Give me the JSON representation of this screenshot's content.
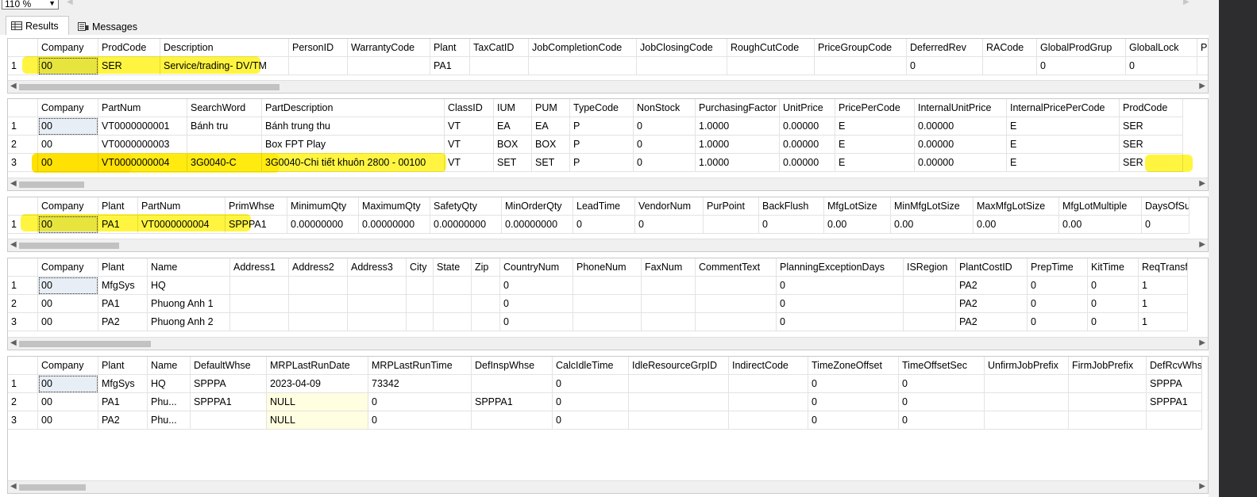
{
  "toolbar": {
    "zoom": "110 %"
  },
  "tabs": [
    {
      "label": "Results",
      "icon": "grid-icon"
    },
    {
      "label": "Messages",
      "icon": "messages-icon"
    }
  ],
  "grids": [
    {
      "name": "prodgroup",
      "columns": [
        "Company",
        "ProdCode",
        "Description",
        "PersonID",
        "WarrantyCode",
        "Plant",
        "TaxCatID",
        "JobCompletionCode",
        "JobClosingCode",
        "RoughCutCode",
        "PriceGroupCode",
        "DeferredRev",
        "RACode",
        "GlobalProdGrup",
        "GlobalLock",
        "P"
      ],
      "rows": [
        [
          "1",
          "00",
          "SER",
          "Service/trading- DV/TM",
          "",
          "",
          "PA1",
          "",
          "",
          "",
          "",
          "",
          "0",
          "",
          "0",
          "0",
          ""
        ]
      ]
    },
    {
      "name": "part",
      "columns": [
        "Company",
        "PartNum",
        "SearchWord",
        "PartDescription",
        "ClassID",
        "IUM",
        "PUM",
        "TypeCode",
        "NonStock",
        "PurchasingFactor",
        "UnitPrice",
        "PricePerCode",
        "InternalUnitPrice",
        "InternalPricePerCode",
        "ProdCode"
      ],
      "rows": [
        [
          "1",
          "00",
          "VT0000000001",
          "Bánh tru",
          "Bánh trung thu",
          "VT",
          "EA",
          "EA",
          "P",
          "0",
          "1.0000",
          "0.00000",
          "E",
          "0.00000",
          "E",
          "SER"
        ],
        [
          "2",
          "00",
          "VT0000000003",
          "",
          "Box FPT Play",
          "VT",
          "BOX",
          "BOX",
          "P",
          "0",
          "1.0000",
          "0.00000",
          "E",
          "0.00000",
          "E",
          "SER"
        ],
        [
          "3",
          "00",
          "VT0000000004",
          "3G0040-C",
          "3G0040-Chi tiết khuôn 2800 - 00100",
          "VT",
          "SET",
          "SET",
          "P",
          "0",
          "1.0000",
          "0.00000",
          "E",
          "0.00000",
          "E",
          "SER"
        ]
      ]
    },
    {
      "name": "partplant",
      "columns": [
        "Company",
        "Plant",
        "PartNum",
        "PrimWhse",
        "MinimumQty",
        "MaximumQty",
        "SafetyQty",
        "MinOrderQty",
        "LeadTime",
        "VendorNum",
        "PurPoint",
        "BackFlush",
        "MfgLotSize",
        "MinMfgLotSize",
        "MaxMfgLotSize",
        "MfgLotMultiple",
        "DaysOfSu"
      ],
      "rows": [
        [
          "1",
          "00",
          "PA1",
          "VT0000000004",
          "SPPPA1",
          "0.00000000",
          "0.00000000",
          "0.00000000",
          "0.00000000",
          "0",
          "0",
          "",
          "0",
          "0.00",
          "0.00",
          "0.00",
          "0.00",
          "0"
        ]
      ]
    },
    {
      "name": "plant",
      "columns": [
        "Company",
        "Plant",
        "Name",
        "Address1",
        "Address2",
        "Address3",
        "City",
        "State",
        "Zip",
        "CountryNum",
        "PhoneNum",
        "FaxNum",
        "CommentText",
        "PlanningExceptionDays",
        "ISRegion",
        "PlantCostID",
        "PrepTime",
        "KitTime",
        "ReqTransfe"
      ],
      "rows": [
        [
          "1",
          "00",
          "MfgSys",
          "HQ",
          "",
          "",
          "",
          "",
          "",
          "",
          "0",
          "",
          "",
          "",
          "0",
          "",
          "PA2",
          "0",
          "0",
          "1"
        ],
        [
          "2",
          "00",
          "PA1",
          "Phuong Anh 1",
          "",
          "",
          "",
          "",
          "",
          "",
          "0",
          "",
          "",
          "",
          "0",
          "",
          "PA2",
          "0",
          "0",
          "1"
        ],
        [
          "3",
          "00",
          "PA2",
          "Phuong Anh 2",
          "",
          "",
          "",
          "",
          "",
          "",
          "0",
          "",
          "",
          "",
          "0",
          "",
          "PA2",
          "0",
          "0",
          "1"
        ]
      ]
    },
    {
      "name": "plantconfig",
      "columns": [
        "Company",
        "Plant",
        "Name",
        "DefaultWhse",
        "MRPLastRunDate",
        "MRPLastRunTime",
        "DefInspWhse",
        "CalcIdleTime",
        "IdleResourceGrpID",
        "IndirectCode",
        "TimeZoneOffset",
        "TimeOffsetSec",
        "UnfirmJobPrefix",
        "FirmJobPrefix",
        "DefRcvWhs"
      ],
      "rows": [
        [
          "1",
          "00",
          "MfgSys",
          "HQ",
          "SPPPA",
          "2023-04-09",
          "73342",
          "",
          "0",
          "",
          "",
          "0",
          "0",
          "",
          "",
          "SPPPA"
        ],
        [
          "2",
          "00",
          "PA1",
          "Phu...",
          "SPPPA1",
          "NULL",
          "0",
          "SPPPA1",
          "0",
          "",
          "",
          "0",
          "0",
          "",
          "",
          "SPPPA1"
        ],
        [
          "3",
          "00",
          "PA2",
          "Phu...",
          "",
          "NULL",
          "0",
          "",
          "0",
          "",
          "",
          "0",
          "0",
          "",
          "",
          ""
        ]
      ]
    }
  ]
}
